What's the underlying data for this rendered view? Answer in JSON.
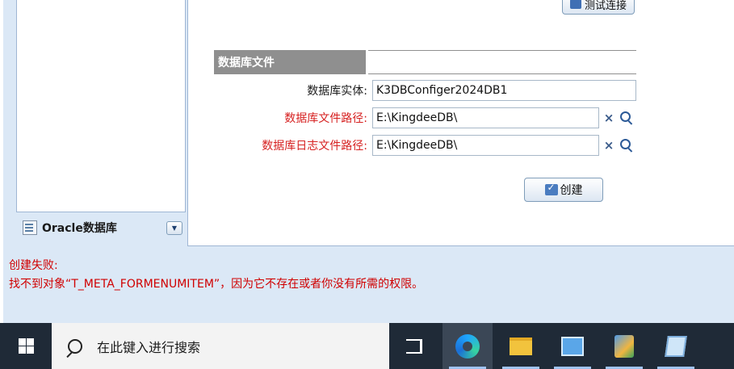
{
  "left_panel": {
    "group_label": "Oracle数据库"
  },
  "toolbar": {
    "test_connection_label": "测试连接"
  },
  "section": {
    "title": "数据库文件"
  },
  "fields": {
    "db_entity": {
      "label": "数据库实体:",
      "value": "K3DBConfiger2024DB1",
      "required": false
    },
    "db_file_path": {
      "label": "数据库文件路径:",
      "value": "E:\\KingdeeDB\\",
      "required": true
    },
    "db_log_path": {
      "label": "数据库日志文件路径:",
      "value": "E:\\KingdeeDB\\",
      "required": true
    }
  },
  "buttons": {
    "create_label": "创建"
  },
  "error": {
    "line1": "创建失败:",
    "line2": "找不到对象“T_META_FORMENUMITEM”，因为它不存在或者你没有所需的权限。"
  },
  "taskbar": {
    "search_placeholder": "在此键入进行搜索",
    "items": [
      "task-view",
      "edge",
      "file-explorer",
      "kingdee-app",
      "installer-app",
      "notepad-app"
    ]
  },
  "colors": {
    "required_label": "#d62020",
    "error_text": "#d00000",
    "section_header_bg": "#8f8f8f",
    "app_bg": "#dbe8f6",
    "taskbar_bg": "#1f2a37"
  }
}
